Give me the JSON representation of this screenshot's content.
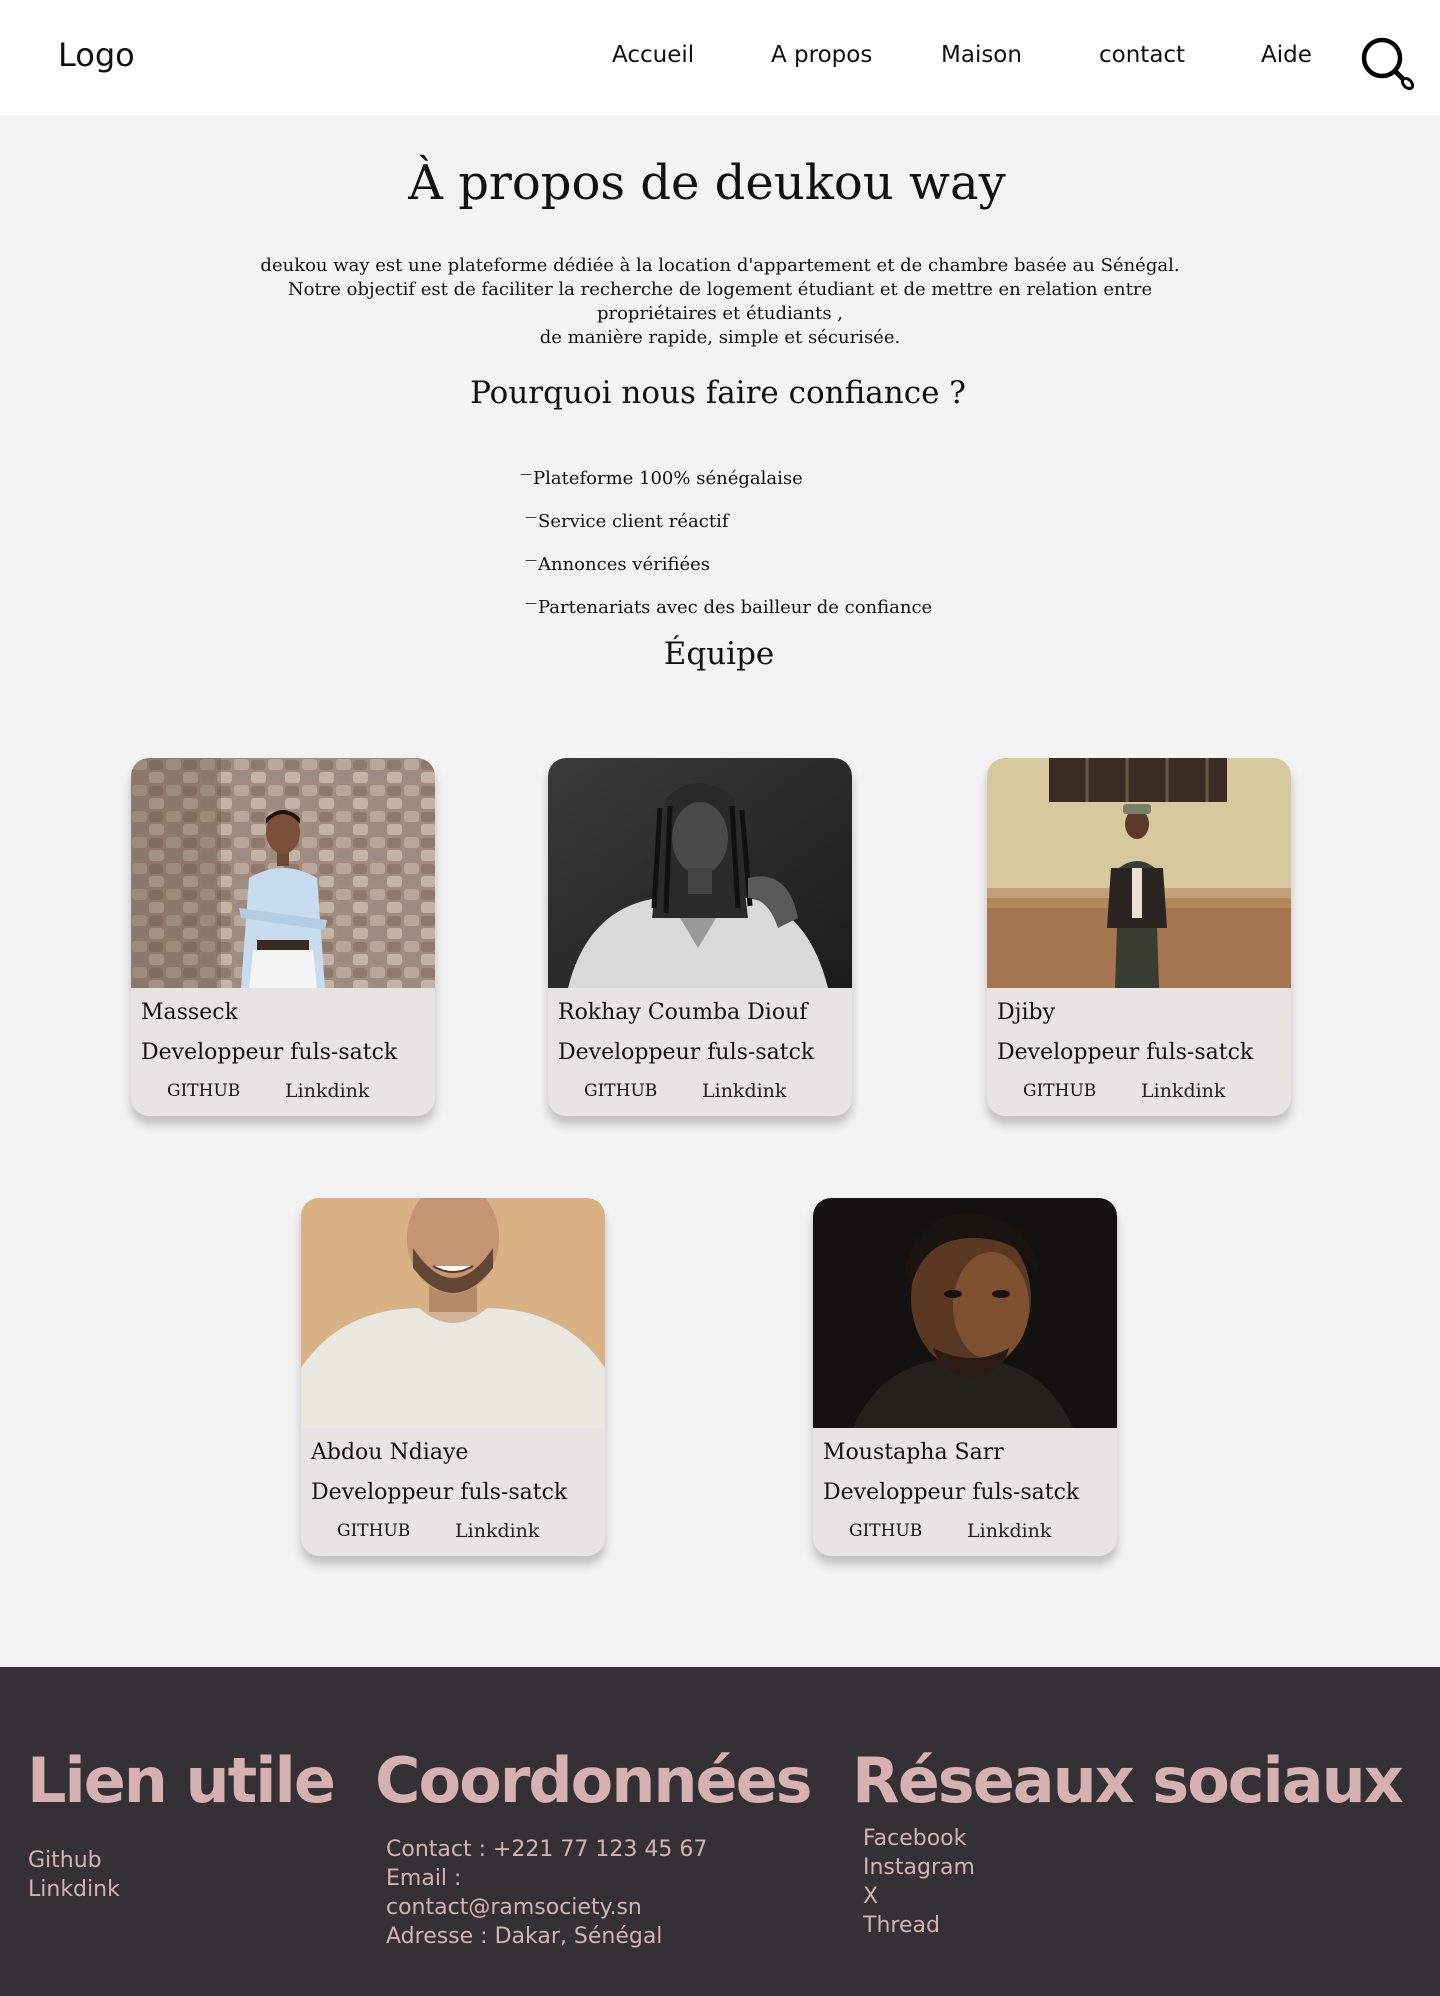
{
  "header": {
    "logo": "Logo",
    "nav": [
      "Accueil",
      "A propos",
      "Maison",
      "contact",
      "Aide"
    ],
    "search_icon": "search-icon"
  },
  "about": {
    "title": "À propos de deukou way",
    "description_lines": [
      "deukou way  est une plateforme dédiée à la location d'appartement et de chambre basée   au Sénégal.",
      "Notre objectif est de faciliter la recherche de logement étudiant et de mettre en relation entre",
      "propriétaires et étudiants ,",
      "de manière rapide, simple et sécurisée."
    ],
    "why_title": "Pourquoi nous faire confiance ?",
    "why_items": [
      "Plateforme 100% sénégalaise",
      "Service client réactif",
      "Annonces vérifiées",
      "Partenariats avec des bailleur de confiance"
    ],
    "team_title": "Équipe"
  },
  "team": [
    {
      "name": "Masseck",
      "role": "Developpeur fuls-satck",
      "github": "GITHUB",
      "linkedin": "Linkdink"
    },
    {
      "name": "Rokhay Coumba Diouf",
      "role": "Developpeur fuls-satck",
      "github": "GITHUB",
      "linkedin": "Linkdink"
    },
    {
      "name": "Djiby",
      "role": "Developpeur fuls-satck",
      "github": "GITHUB",
      "linkedin": "Linkdink"
    },
    {
      "name": "Abdou Ndiaye",
      "role": "Developpeur fuls-satck",
      "github": "GITHUB",
      "linkedin": "Linkdink"
    },
    {
      "name": "Moustapha Sarr",
      "role": "Developpeur fuls-satck",
      "github": "GITHUB",
      "linkedin": "Linkdink"
    }
  ],
  "footer": {
    "links_title": "Lien utile",
    "links": [
      "Github",
      "Linkdink"
    ],
    "contact_title": "Coordonnées",
    "contact_lines": [
      "Contact : +221 77 123 45 67",
      "Email :",
      "contact@ramsociety.sn",
      "Adresse : Dakar, Sénégal"
    ],
    "social_title": "Réseaux sociaux",
    "social": [
      "Facebook",
      "Instagram",
      "X",
      "Thread"
    ]
  },
  "colors": {
    "page_bg": "#f3f3f3",
    "header_bg": "#ffffff",
    "card_bg": "#e6e5e3",
    "footer_bg": "#333133",
    "footer_text": "#d7b1b1"
  }
}
